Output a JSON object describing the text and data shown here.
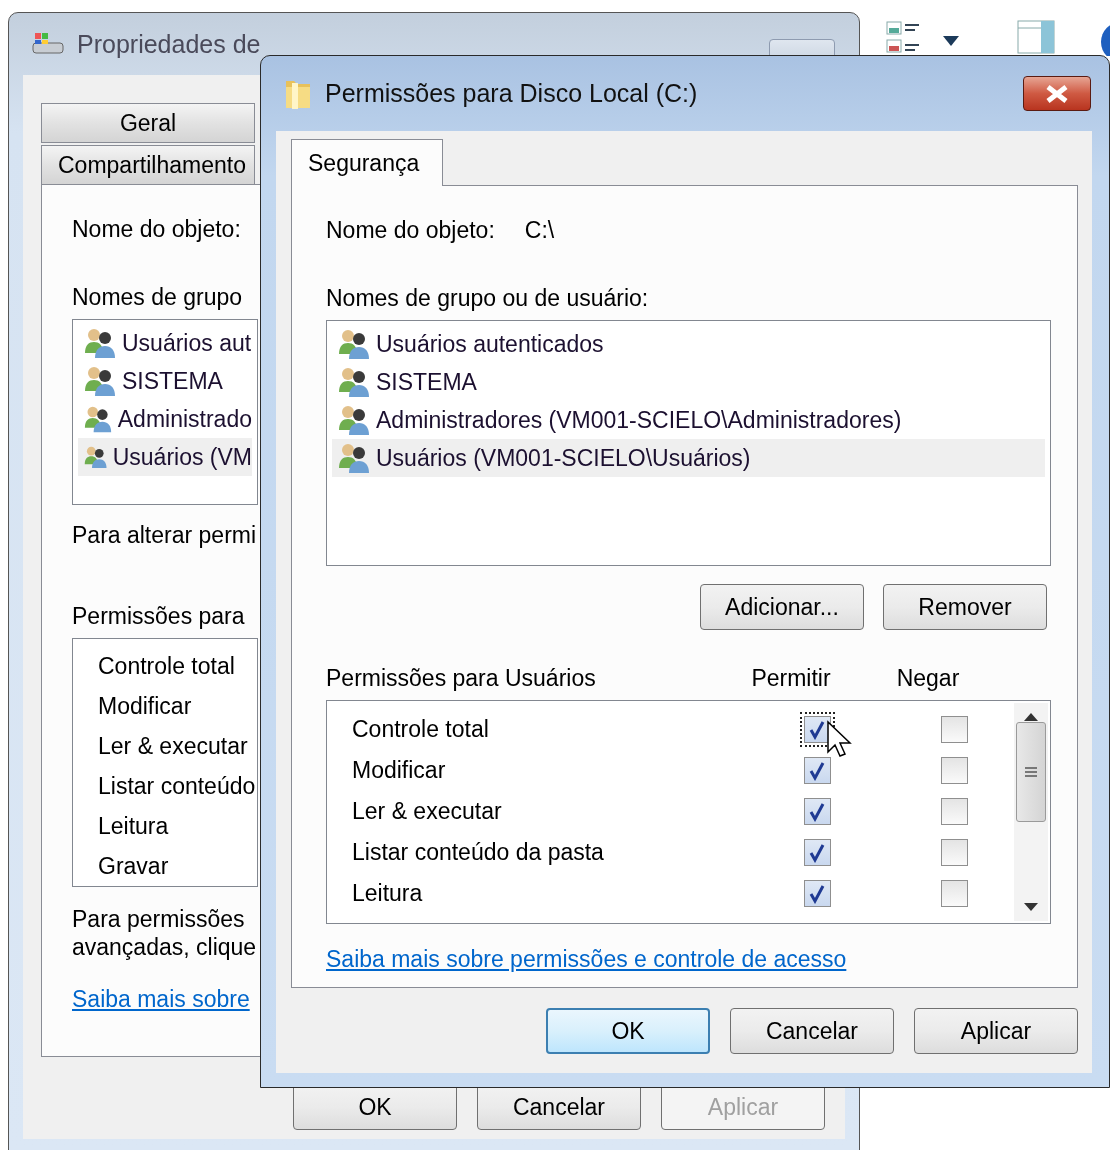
{
  "back_window": {
    "title": "Propriedades de",
    "tabs": [
      {
        "label": "Geral",
        "selected": false
      },
      {
        "label": "Compartilhamento",
        "selected": false
      }
    ],
    "object_name_label": "Nome do objeto:",
    "group_label": "Nomes de grupo",
    "users": [
      {
        "name": "Usuários aut",
        "selected": false
      },
      {
        "name": "SISTEMA",
        "selected": false
      },
      {
        "name": "Administrado",
        "selected": false
      },
      {
        "name": "Usuários (VM",
        "selected": true
      }
    ],
    "change_hint": "Para alterar permi",
    "permissions_label": "Permissões para",
    "permissions": [
      "Controle total",
      "Modificar",
      "Ler & executar",
      "Listar conteúdo",
      "Leitura",
      "Gravar"
    ],
    "advanced_hint": [
      "Para permissões",
      "avançadas, clique"
    ],
    "link": "Saiba mais sobre",
    "buttons": [
      {
        "label": "OK",
        "disabled": false
      },
      {
        "label": "Cancelar",
        "disabled": false
      },
      {
        "label": "Aplicar",
        "disabled": true
      }
    ]
  },
  "dialog": {
    "title": "Permissões para Disco Local (C:)",
    "tabs": [
      {
        "label": "Segurança",
        "selected": true
      }
    ],
    "object_name_label": "Nome do objeto:",
    "object_name": "C:\\",
    "group_label": "Nomes de grupo ou de usuário:",
    "users": [
      {
        "name": "Usuários autenticados",
        "selected": false
      },
      {
        "name": "SISTEMA",
        "selected": false
      },
      {
        "name": "Administradores (VM001-SCIELO\\Administradores)",
        "selected": false
      },
      {
        "name": "Usuários (VM001-SCIELO\\Usuários)",
        "selected": true
      }
    ],
    "user_buttons": [
      "Adicionar...",
      "Remover"
    ],
    "permissions_label": "Permissões para Usuários",
    "allow_header": "Permitir",
    "deny_header": "Negar",
    "permissions": [
      {
        "name": "Controle total",
        "allow": true,
        "deny": false,
        "focused": true
      },
      {
        "name": "Modificar",
        "allow": true,
        "deny": false,
        "focused": false
      },
      {
        "name": "Ler & executar",
        "allow": true,
        "deny": false,
        "focused": false
      },
      {
        "name": "Listar conteúdo da pasta",
        "allow": true,
        "deny": false,
        "focused": false
      },
      {
        "name": "Leitura",
        "allow": true,
        "deny": false,
        "focused": false
      }
    ],
    "link": "Saiba mais sobre permissões e controle de acesso",
    "buttons": [
      {
        "label": "OK",
        "default": true
      },
      {
        "label": "Cancelar",
        "default": false
      },
      {
        "label": "Aplicar",
        "default": false
      }
    ]
  }
}
